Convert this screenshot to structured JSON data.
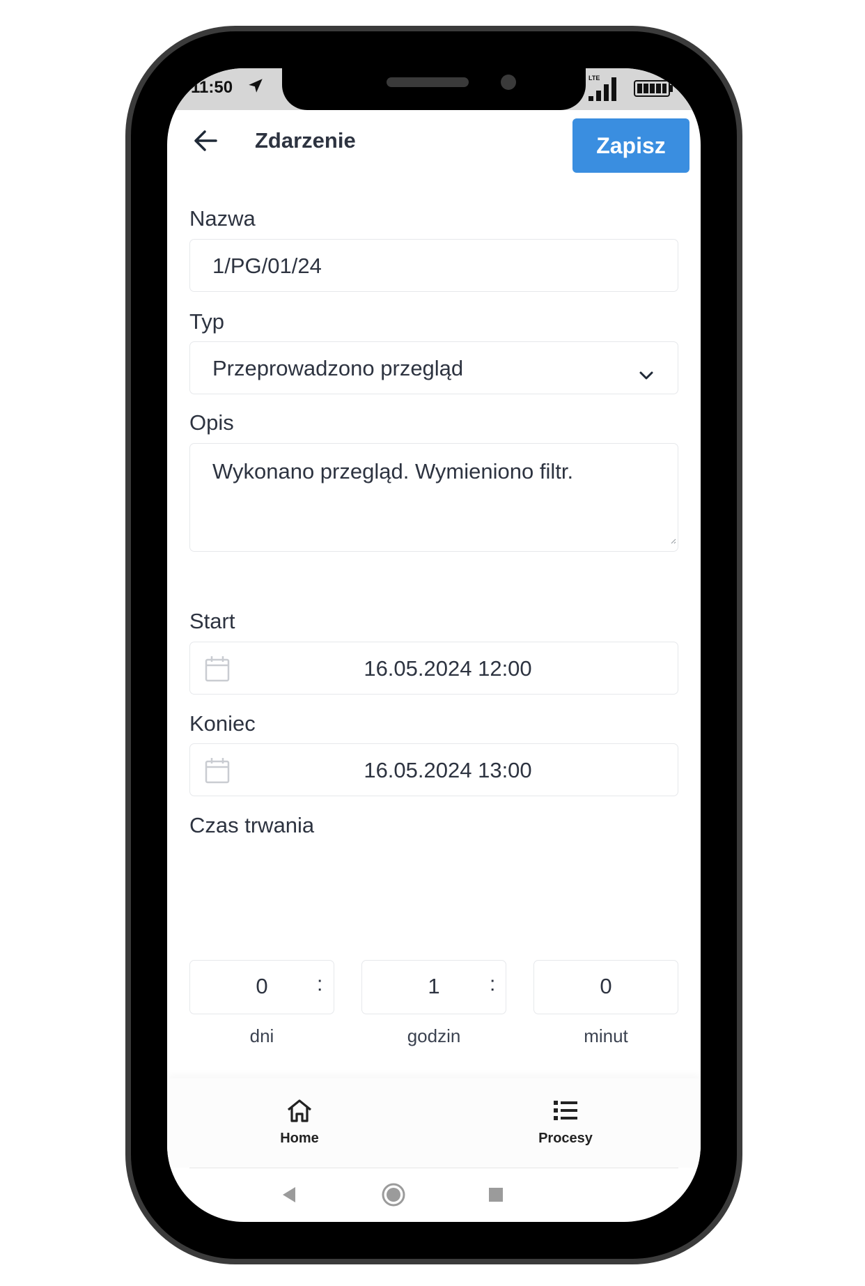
{
  "status": {
    "time": "11:50",
    "network": "LTE"
  },
  "header": {
    "title": "Zdarzenie",
    "save_label": "Zapisz"
  },
  "form": {
    "name": {
      "label": "Nazwa",
      "value": "1/PG/01/24"
    },
    "type": {
      "label": "Typ",
      "value": "Przeprowadzono przegląd"
    },
    "description": {
      "label": "Opis",
      "value": "Wykonano przegląd. Wymieniono filtr."
    },
    "start": {
      "label": "Start",
      "value": "16.05.2024 12:00"
    },
    "end": {
      "label": "Koniec",
      "value": "16.05.2024 13:00"
    },
    "duration": {
      "label": "Czas trwania",
      "separator": ":",
      "days": {
        "value": "0",
        "unit": "dni"
      },
      "hours": {
        "value": "1",
        "unit": "godzin"
      },
      "minutes": {
        "value": "0",
        "unit": "minut"
      }
    }
  },
  "tabs": [
    {
      "label": "Home",
      "icon": "home-icon"
    },
    {
      "label": "Procesy",
      "icon": "list-icon"
    }
  ],
  "colors": {
    "accent": "#3a8ee0",
    "text": "#2d3340",
    "border": "#e6e8eb"
  }
}
